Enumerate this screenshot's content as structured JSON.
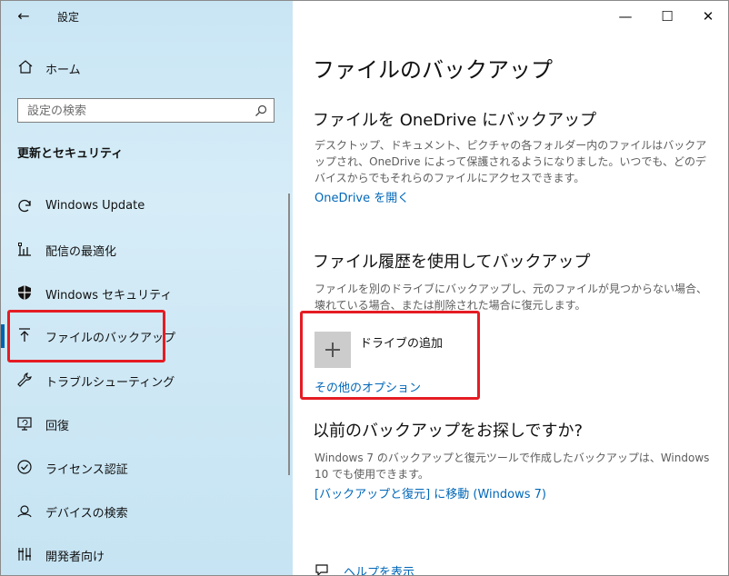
{
  "window": {
    "title": "設定",
    "back": "←",
    "minimize": "—",
    "maximize": "☐",
    "close": "✕"
  },
  "sidebar": {
    "home_label": "ホーム",
    "search_placeholder": "設定の検索",
    "section_title": "更新とセキュリティ",
    "items": [
      {
        "label": "Windows Update",
        "icon": "refresh-icon"
      },
      {
        "label": "配信の最適化",
        "icon": "delivery-optimization-icon"
      },
      {
        "label": "Windows セキュリティ",
        "icon": "shield-icon"
      },
      {
        "label": "ファイルのバックアップ",
        "icon": "backup-arrow-icon",
        "active": true
      },
      {
        "label": "トラブルシューティング",
        "icon": "wrench-icon"
      },
      {
        "label": "回復",
        "icon": "recovery-icon"
      },
      {
        "label": "ライセンス認証",
        "icon": "checkmark-circle-icon"
      },
      {
        "label": "デバイスの検索",
        "icon": "find-device-icon"
      },
      {
        "label": "開発者向け",
        "icon": "developer-icon"
      }
    ]
  },
  "main": {
    "page_title": "ファイルのバックアップ",
    "onedrive": {
      "heading": "ファイルを OneDrive にバックアップ",
      "desc": "デスクトップ、ドキュメント、ピクチャの各フォルダー内のファイルはバックアップされ、OneDrive によって保護されるようになりました。いつでも、どのデバイスからでもそれらのファイルにアクセスできます。",
      "link": "OneDrive を開く"
    },
    "file_history": {
      "heading": "ファイル履歴を使用してバックアップ",
      "desc": "ファイルを別のドライブにバックアップし、元のファイルが見つからない場合、壊れている場合、または削除された場合に復元します。",
      "add_drive": "ドライブの追加",
      "more_options": "その他のオプション"
    },
    "older": {
      "heading": "以前のバックアップをお探しですか?",
      "desc": "Windows 7 のバックアップと復元ツールで作成したバックアップは、Windows 10 でも使用できます。",
      "link": "[バックアップと復元] に移動 (Windows 7)"
    },
    "help_link": "ヘルプを表示"
  },
  "colors": {
    "accent": "#0063b1",
    "link": "#0067b8",
    "highlight": "#e51c23"
  }
}
